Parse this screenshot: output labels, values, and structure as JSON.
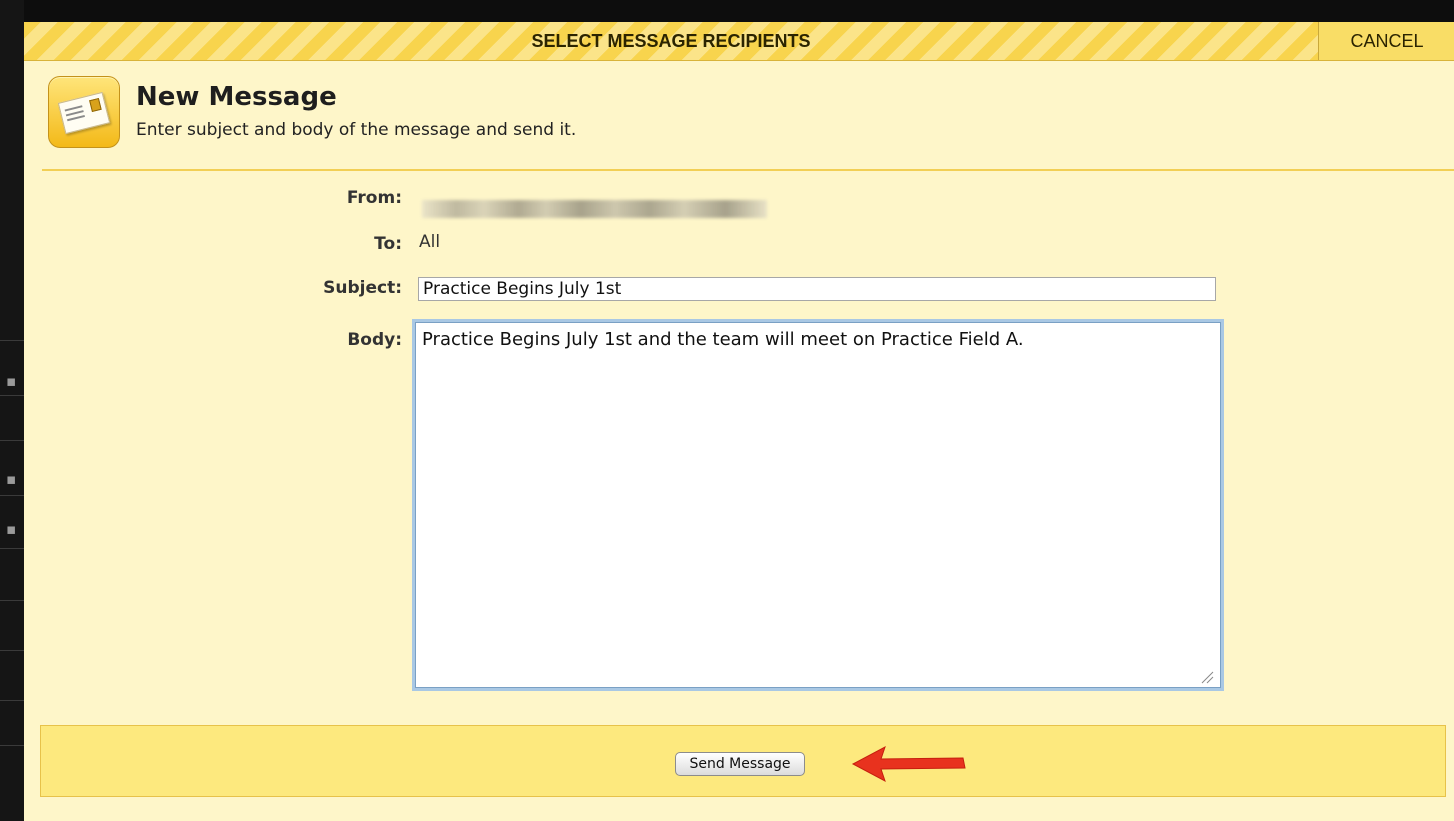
{
  "dialog": {
    "title": "SELECT MESSAGE RECIPIENTS",
    "cancel_label": "CANCEL"
  },
  "header": {
    "icon": "envelope-icon",
    "title": "New Message",
    "subtitle": "Enter subject and body of the message and send it."
  },
  "form": {
    "from_label": "From:",
    "to_label": "To:",
    "to_value": "All",
    "subject_label": "Subject:",
    "subject_value": "Practice Begins July 1st",
    "body_label": "Body:",
    "body_value": "Practice Begins July 1st and the team will meet on Practice Field A."
  },
  "footer": {
    "send_label": "Send Message",
    "annotation": "red-arrow-pointing-left"
  },
  "colors": {
    "dialog_bg": "#fef6c9",
    "titlebar_stripe": "#f8d44d",
    "footer_bg": "#fde97e",
    "arrow": "#e8321e"
  }
}
